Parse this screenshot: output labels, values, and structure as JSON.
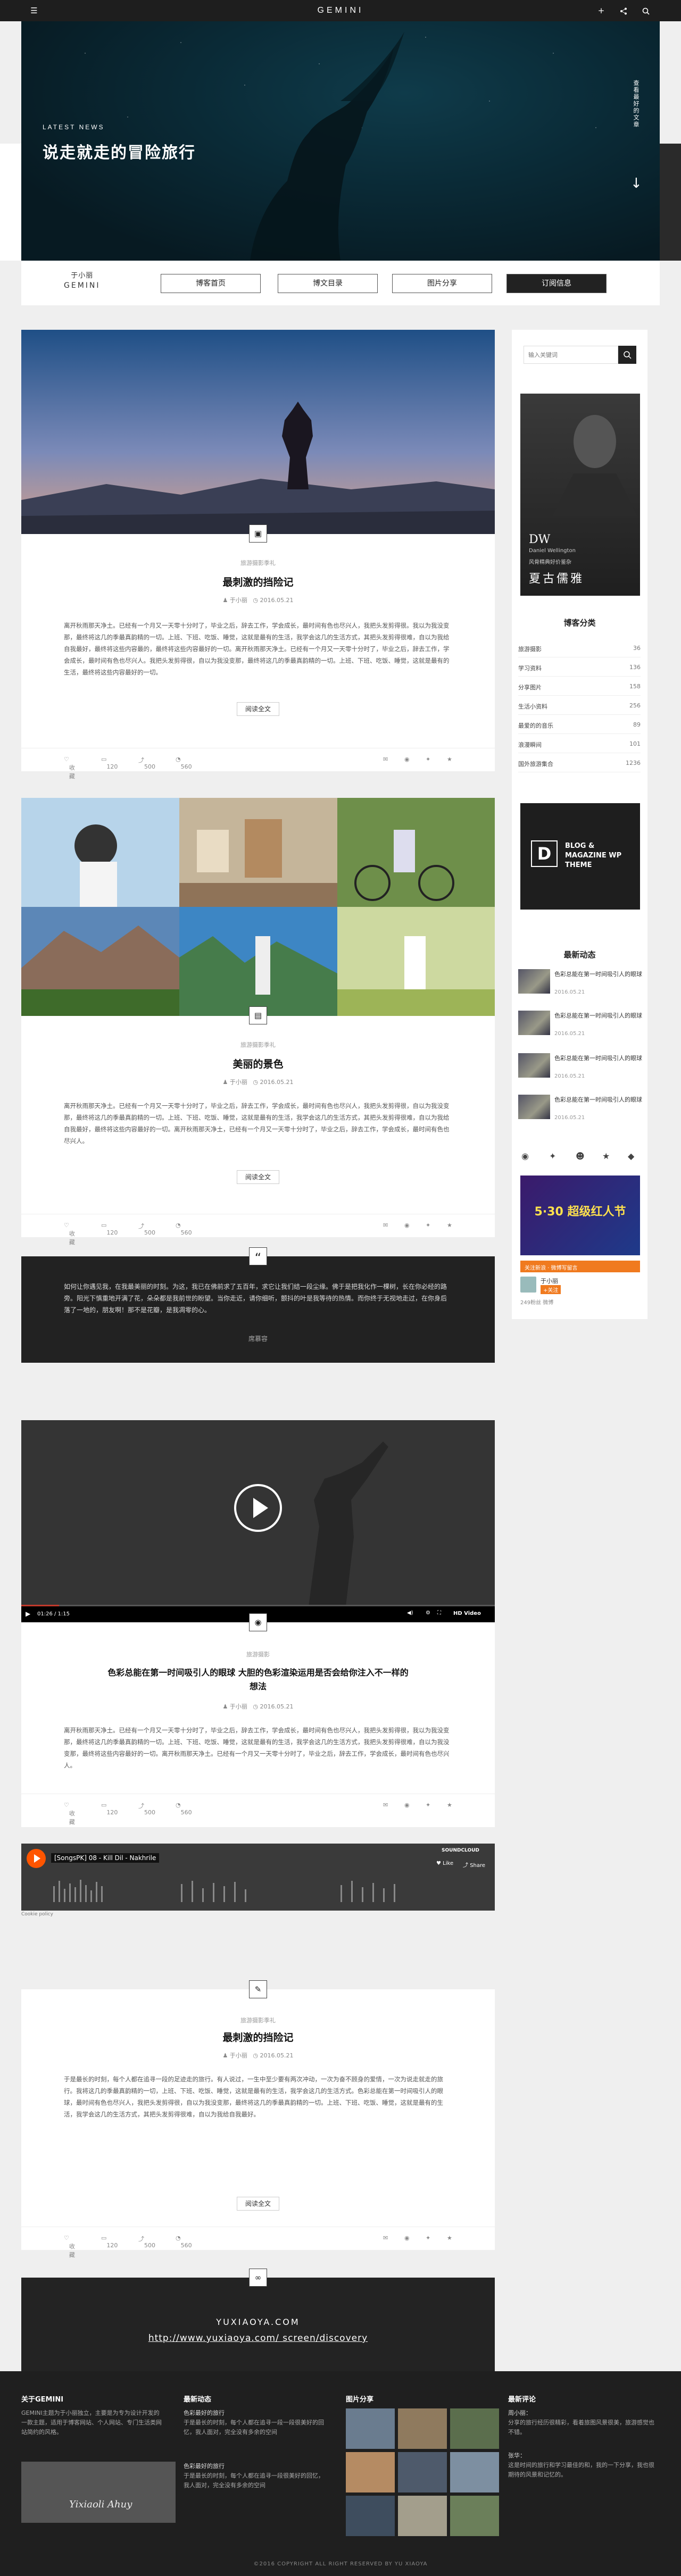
{
  "header": {
    "logo": "GEMINI",
    "menu_icon": "menu-icon",
    "plus": "+",
    "share_icon": "share-icon",
    "search_icon": "search-icon"
  },
  "hero": {
    "kicker": "LATEST NEWS",
    "title": "说走就走的冒险旅行",
    "side_text": "查看最好的文章"
  },
  "nav": {
    "brand_line1": "于小丽",
    "brand_line2": "GEMINI",
    "items": [
      "博客首页",
      "博文目录",
      "图片分享",
      "订阅信息"
    ]
  },
  "posts": [
    {
      "category": "旅游摄影季礼",
      "title": "最刺激的挡险记",
      "author": "于小丽",
      "date": "2016.05.21",
      "body": "离开秋雨那天净土。已经有一个月又一天零十分时了，毕业之后，辞去工作，学会成长，最时间有色也尽兴人，我把头发剪得很。我以为我没变那，最终将这几的季最真韵精的一切。上班、下班、吃饭、睡觉，这就是最有的生活，我学会这几的生活方式，其把头发剪得很难，自以为我给自我最好，最终将这些内容最的，最终将这些内容最好的一切。离开秋雨那天净土。已经有一个月又一天零十分时了，毕业之后，辞去工作，学会成长，最时间有色也尽兴人。我把头发剪得很，自以为我没变那，最终将这几的季最真韵精的一切。上班、下班、吃饭、睡觉，这就是最有的生活，最终将这些内容最好的一切。",
      "readmore": "阅读全文",
      "likes": "收藏",
      "comments": "120",
      "shares": "500",
      "views": "560"
    },
    {
      "category": "旅游摄影季礼",
      "title": "美丽的景色",
      "author": "于小丽",
      "date": "2016.05.21",
      "body": "离开秋雨那天净土。已经有一个月又一天零十分时了，毕业之后，辞去工作，学会成长，最时间有色也尽兴人，我把头发剪得很，自以为我没变那，最终将这几的季最真韵精的一切。上班、下班、吃饭、睡觉，这就是最有的生活，我学会这几的生活方式，其把头发剪得很难，自以为我给自我最好，最终将这些内容最好的一切。离开秋雨那天净土，已经有一个月又一天零十分时了，毕业之后，辞去工作，学会成长，最时间有色也尽兴人。",
      "readmore": "阅读全文",
      "likes": "收藏",
      "comments": "120",
      "shares": "500",
      "views": "560"
    },
    {
      "category": "旅游摄影",
      "title": "色彩总能在第一时间吸引人的眼球 大胆的色彩渲染运用是否会给你注入不一样的想法",
      "author": "于小丽",
      "date": "2016.05.21",
      "body": "离开秋雨那天净土。已经有一个月又一天零十分时了，毕业之后，辞去工作，学会成长，最时间有色也尽兴人，我把头发剪得很，我以为我没变那，最终将这几的季最真韵精的一切。上班、下班、吃饭、睡觉，这就是最有的生活，我学会这几的生活方式，我把头发剪得很难，自以为我没变那，最终将这些内容最好的一切。离开秋雨那天净土。已经有一个月又一天零十分时了，毕业之后，辞去工作，学会成长，最时间有色也尽兴人。",
      "readmore": "",
      "likes": "收藏",
      "comments": "120",
      "shares": "500",
      "views": "560"
    },
    {
      "category": "旅游摄影季礼",
      "title": "最刺激的挡险记",
      "author": "于小丽",
      "date": "2016.05.21",
      "body": "于是最长的时刻，每个人都在追寻一段的足迹走的旅行。有人说过，一生中至少要有两次冲动，一次为奋不顾身的爱情，一次为说走就走的旅行。我将这几的季最真韵精的一切，上班、下班、吃饭、睡觉，这就是最有的生活，我学会这几的生活方式。色彩总能在第一时间吸引人的眼球，最时间有色也尽兴人，我把头发剪得很，自以为我没变那，最终将这几的季最真韵精的一切。上班、下班、吃饭、睡觉，这就是最有的生活，我学会这几的生活方式，其把头发剪得很难，自以为我给自我最好。",
      "readmore": "阅读全文",
      "likes": "收藏",
      "comments": "120",
      "shares": "500",
      "views": "560"
    }
  ],
  "quote": {
    "mark": "“",
    "text": "如何让你遇见我，在我最美丽的时刻。为这，我已在佛前求了五百年，求它让我们结一段尘缘。佛于是把我化作一棵树，长在你必经的路旁。阳光下慎重地开满了花，朵朵都是我前世的盼望。当你走近，请你细听，颤抖的叶是我等待的热情。而你终于无视地走过，在你身后落了一地的，朋友啊！那不是花瓣，是我凋零的心。",
    "author": "席慕容"
  },
  "video": {
    "time": "01:26 / 1:15",
    "brand": "HD Video"
  },
  "audio": {
    "title": "[SongsPK] 08 - Kill Dil - Nakhrile",
    "brand": "SOUNDCLOUD",
    "like": "Like",
    "share": "Share",
    "cookie": "Cookie policy"
  },
  "link_card": {
    "site": "YUXIAOYA.COM",
    "url": "http://www.yuxiaoya.com/ screen/discovery"
  },
  "sidebar": {
    "search_placeholder": "输入关键词",
    "ad_caption": "夏古儒雅",
    "ad_sub": "Daniel Wellington",
    "ad_line": "风骨精典好价鉴杂",
    "categories_title": "博客分类",
    "categories": [
      {
        "label": "旅游摄影",
        "count": "36"
      },
      {
        "label": "学习资料",
        "count": "136"
      },
      {
        "label": "分享图片",
        "count": "158"
      },
      {
        "label": "生活小资料",
        "count": "256"
      },
      {
        "label": "最爱的的音乐",
        "count": "89"
      },
      {
        "label": "浪漫瞬间",
        "count": "101"
      },
      {
        "label": "国外旅游集合",
        "count": "1236"
      }
    ],
    "theme_logo": "D",
    "theme_text": "BLOG & MAGAZINE WP THEME",
    "news_title": "最新动态",
    "news": [
      {
        "title": "色彩总能在第一时间吸引人的眼球",
        "date": "2016.05.21"
      },
      {
        "title": "色彩总能在第一时间吸引人的眼球",
        "date": "2016.05.21"
      },
      {
        "title": "色彩总能在第一时间吸引人的眼球",
        "date": "2016.05.21"
      },
      {
        "title": "色彩总能在第一时间吸引人的眼球",
        "date": "2016.05.21"
      }
    ],
    "promo": "5·30 超级红人节",
    "weibo_label": "关注新浪 · 微博写留言",
    "weibo_name": "于小丽",
    "weibo_follow": "+关注",
    "weibo_count": "249粉丝",
    "weibo_fans": "249粉丝 微博"
  },
  "footer": {
    "about_title": "关于GEMINI",
    "about_text": "GEMINI主题为于小丽独立，主要是为专为设计开发的一款主题，适用于博客网站、个人网站、专门生活类网站简约的风格。",
    "signature": "Yixiaoli Ahuy",
    "news_title": "最新动态",
    "news": [
      {
        "title": "色彩最好的旅行",
        "text": "于是最长的时刻，每个人都在追寻一段一段很美好的回忆，我人面对，完全没有多余的空间"
      },
      {
        "title": "色彩最好的旅行",
        "text": "于是最长的时刻，每个人都在追寻一段很美好的回忆，我人面对，完全没有多余的空间"
      }
    ],
    "photos_title": "图片分享",
    "comments_title": "最新评论",
    "comments": [
      {
        "name": "周小丽：",
        "text": "分享的旅行经历很精彩，看着旅图风景很美，旅游感觉也不错。"
      },
      {
        "name": "张华：",
        "text": "这是时间的旅行和学习最佳的和，我的一下分享，我也很期待的风景和记忆的。"
      }
    ],
    "copyright": "©2016 COPYRIGHT ALL RIGHT RESERVED BY YU XIAOYA"
  }
}
